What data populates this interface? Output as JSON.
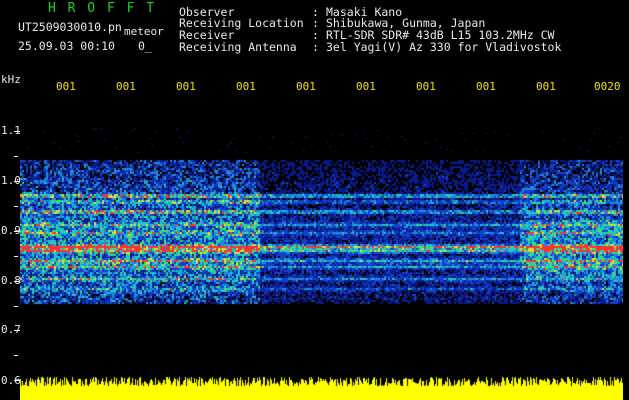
{
  "header": {
    "app_title": "H R O F F T",
    "filename": "UT2509030010.pn",
    "mode_label": "meteor",
    "datetime": "25.09.03 00:10",
    "count": "0_"
  },
  "meta": {
    "rows": [
      {
        "label": "Observer",
        "sep": ":",
        "value": "Masaki Kano"
      },
      {
        "label": "Receiving Location",
        "sep": ":",
        "value": "Shibukawa, Gunma, Japan"
      },
      {
        "label": "Receiver",
        "sep": ":",
        "value": "RTL-SDR SDR# 43dB L15 103.2MHz CW"
      },
      {
        "label": "Receiving Antenna",
        "sep": ":",
        "value": "3el Yagi(V) Az 330 for Vladivostok"
      }
    ]
  },
  "axis": {
    "unit": "kHz",
    "y_ticks": [
      "1.1",
      "1.0",
      "0.9",
      "0.8",
      "0.7",
      "0.6"
    ],
    "minute_ticks": [
      "001",
      "001",
      "001",
      "001",
      "001",
      "001",
      "001",
      "001",
      "001",
      "0020"
    ]
  },
  "colors": {
    "title": "#1fd11f",
    "minute_ticks": "#f0e000",
    "amplitude": "#ffff00",
    "background": "#000000"
  }
}
